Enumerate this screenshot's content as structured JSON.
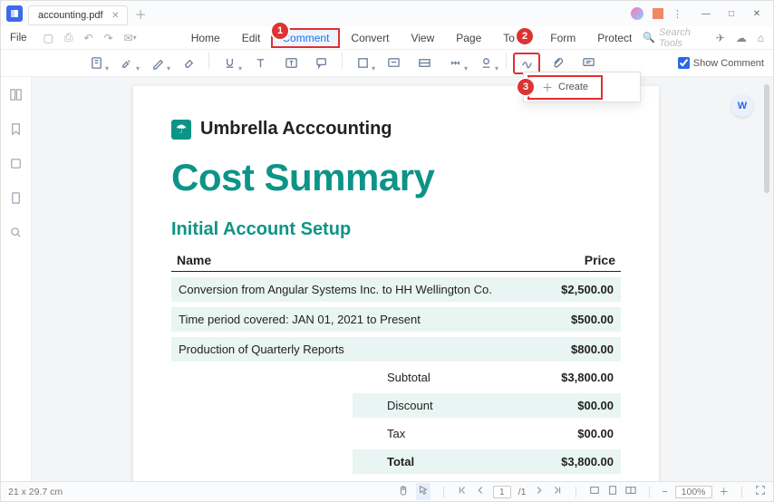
{
  "titlebar": {
    "tab_name": "accounting.pdf"
  },
  "menubar": {
    "file": "File",
    "items": [
      "Home",
      "Edit",
      "Comment",
      "Convert",
      "View",
      "Page",
      "Tools",
      "Form",
      "Protect"
    ],
    "active_index": 2,
    "search_placeholder": "Search Tools"
  },
  "badges": {
    "b1": "1",
    "b2": "2",
    "b3": "3"
  },
  "toolbar": {
    "show_comment_label": "Show Comment"
  },
  "create_dropdown": {
    "label": "Create"
  },
  "document": {
    "brand": "Umbrella Acccounting",
    "title": "Cost Summary",
    "section": "Initial Account Setup",
    "headers": {
      "name": "Name",
      "price": "Price"
    },
    "rows": [
      {
        "name": "Conversion from Angular Systems Inc. to HH Wellington Co.",
        "price": "$2,500.00"
      },
      {
        "name": "Time period covered: JAN 01, 2021 to Present",
        "price": "$500.00"
      },
      {
        "name": "Production of Quarterly Reports",
        "price": "$800.00"
      }
    ],
    "summary": [
      {
        "label": "Subtotal",
        "value": "$3,800.00",
        "band": false
      },
      {
        "label": "Discount",
        "value": "$00.00",
        "band": true
      },
      {
        "label": "Tax",
        "value": "$00.00",
        "band": false
      },
      {
        "label": "Total",
        "value": "$3,800.00",
        "band": true,
        "total": true
      }
    ]
  },
  "statusbar": {
    "dims": "21 x 29.7 cm",
    "page_current": "1",
    "page_total": "/1",
    "zoom": "100%"
  }
}
